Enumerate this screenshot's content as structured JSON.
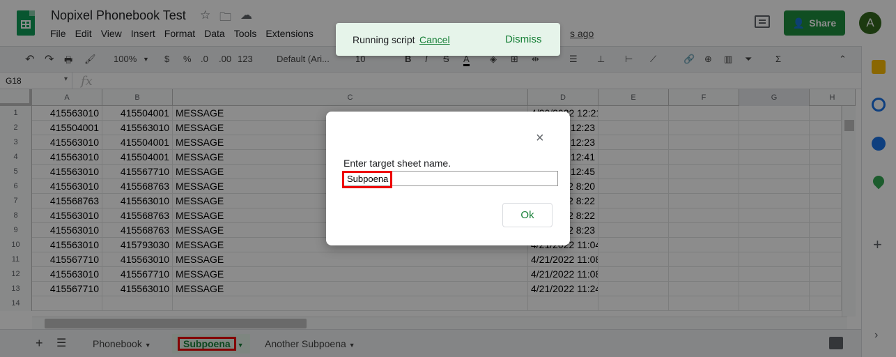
{
  "app": {
    "title": "Nopixel Phonebook Test",
    "last_edit": "s ago",
    "share_label": "Share",
    "avatar_letter": "A"
  },
  "menu": [
    "File",
    "Edit",
    "View",
    "Insert",
    "Format",
    "Data",
    "Tools",
    "Extensions"
  ],
  "toolbar": {
    "zoom": "100%",
    "currency": "$",
    "percent": "%",
    "dec_less": ".0",
    "dec_more": ".00",
    "format_more": "123",
    "font": "Default (Ari...",
    "font_size": "10"
  },
  "formula_bar": {
    "cell_ref": "G18",
    "fx": "fx"
  },
  "columns": [
    "A",
    "B",
    "C",
    "D",
    "E",
    "F",
    "G",
    "H"
  ],
  "rows": [
    {
      "n": "1",
      "a": "415563010",
      "b": "415504001",
      "c": "MESSAGE",
      "d": "4/20/2022 12:21"
    },
    {
      "n": "2",
      "a": "415504001",
      "b": "415563010",
      "c": "MESSAGE",
      "d": "12:23"
    },
    {
      "n": "3",
      "a": "415563010",
      "b": "415504001",
      "c": "MESSAGE",
      "d": "12:23"
    },
    {
      "n": "4",
      "a": "415563010",
      "b": "415504001",
      "c": "MESSAGE",
      "d": "12:41"
    },
    {
      "n": "5",
      "a": "415563010",
      "b": "415567710",
      "c": "MESSAGE",
      "d": "12:45"
    },
    {
      "n": "6",
      "a": "415563010",
      "b": "415568763",
      "c": "MESSAGE",
      "d": "2 8:20"
    },
    {
      "n": "7",
      "a": "415568763",
      "b": "415563010",
      "c": "MESSAGE",
      "d": "2 8:22"
    },
    {
      "n": "8",
      "a": "415563010",
      "b": "415568763",
      "c": "MESSAGE",
      "d": "2 8:22"
    },
    {
      "n": "9",
      "a": "415563010",
      "b": "415568763",
      "c": "MESSAGE",
      "d": "2 8:23"
    },
    {
      "n": "10",
      "a": "415563010",
      "b": "415793030",
      "c": "MESSAGE",
      "d": "4/21/2022 11:04"
    },
    {
      "n": "11",
      "a": "415567710",
      "b": "415563010",
      "c": "MESSAGE",
      "d": "4/21/2022 11:08"
    },
    {
      "n": "12",
      "a": "415563010",
      "b": "415567710",
      "c": "MESSAGE",
      "d": "4/21/2022 11:08"
    },
    {
      "n": "13",
      "a": "415567710",
      "b": "415563010",
      "c": "MESSAGE",
      "d": "4/21/2022 11:24"
    },
    {
      "n": "14",
      "a": "",
      "b": "",
      "c": "",
      "d": ""
    }
  ],
  "sheets": {
    "tab1": "Phonebook",
    "tab2": "Subpoena",
    "tab3": "Another Subpoena"
  },
  "toast": {
    "message": "Running script",
    "cancel": "Cancel",
    "dismiss": "Dismiss"
  },
  "dialog": {
    "prompt": "Enter target sheet name.",
    "input_value": "Subpoena",
    "ok_label": "Ok",
    "close": "×"
  },
  "colors": {
    "accent": "#188038",
    "share_bg": "#1e8e3e",
    "highlight": "#e00000"
  }
}
